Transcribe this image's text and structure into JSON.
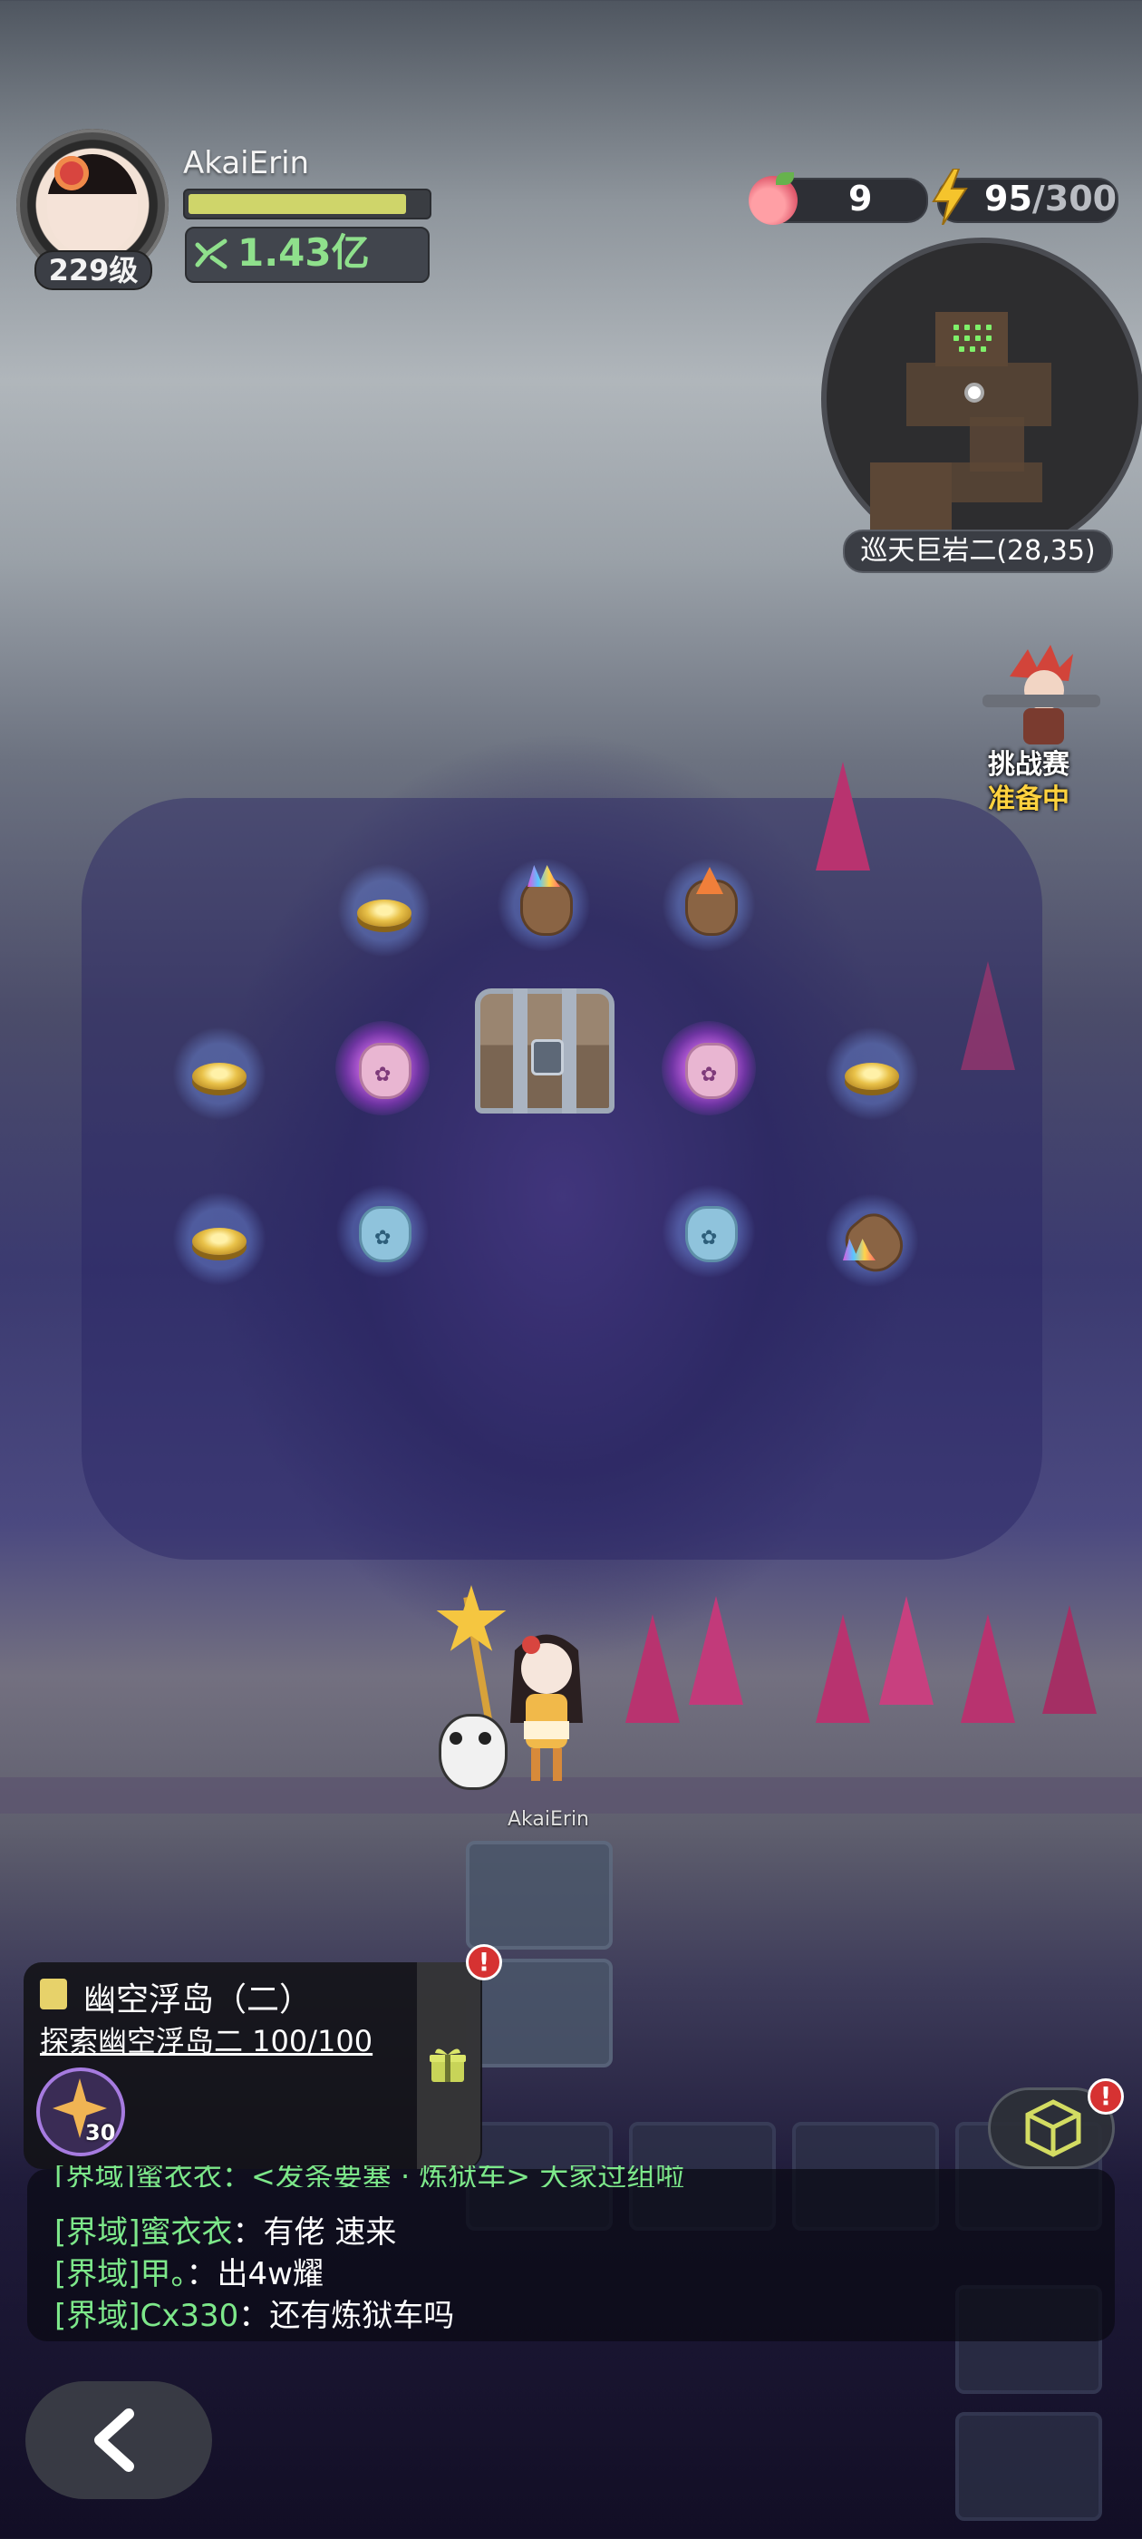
{
  "player": {
    "name": "AkaiErin",
    "level": "229级",
    "power": "1.43亿",
    "hp_fraction": 0.93
  },
  "resources": {
    "peach_count": "9",
    "energy_current": "95",
    "energy_max": "/300"
  },
  "minimap": {
    "location": "巡天巨岩二(28,35)"
  },
  "challenge": {
    "line1": "挑战赛",
    "line2": "准备中"
  },
  "hero_label": "AkaiErin",
  "quest": {
    "title": "幽空浮岛（二）",
    "description": "探索幽空浮岛二 100/100",
    "reward_count": "30",
    "alert": "!"
  },
  "chat": {
    "partial_line": "[界域]蜜衣衣：<发条要塞 · 炼狱车> 大家过组啦",
    "lines": [
      {
        "tag": "[界域]蜜衣衣",
        "text": "：有佬 速来"
      },
      {
        "tag": "[界域]甲。",
        "text": "：出4w耀"
      },
      {
        "tag": "[界域]Cx330",
        "text": "：还有炼狱车吗"
      }
    ]
  },
  "cube_alert": "!",
  "colors": {
    "power_green": "#8fe08c",
    "chat_tag_green": "#7de88a",
    "challenge_yellow": "#ffd23f",
    "alert_red": "#d63232"
  },
  "icons": [
    "peach-icon",
    "lightning-icon",
    "fist-icon",
    "task-list-icon",
    "gift-icon",
    "cube-icon",
    "back-arrow-icon"
  ]
}
